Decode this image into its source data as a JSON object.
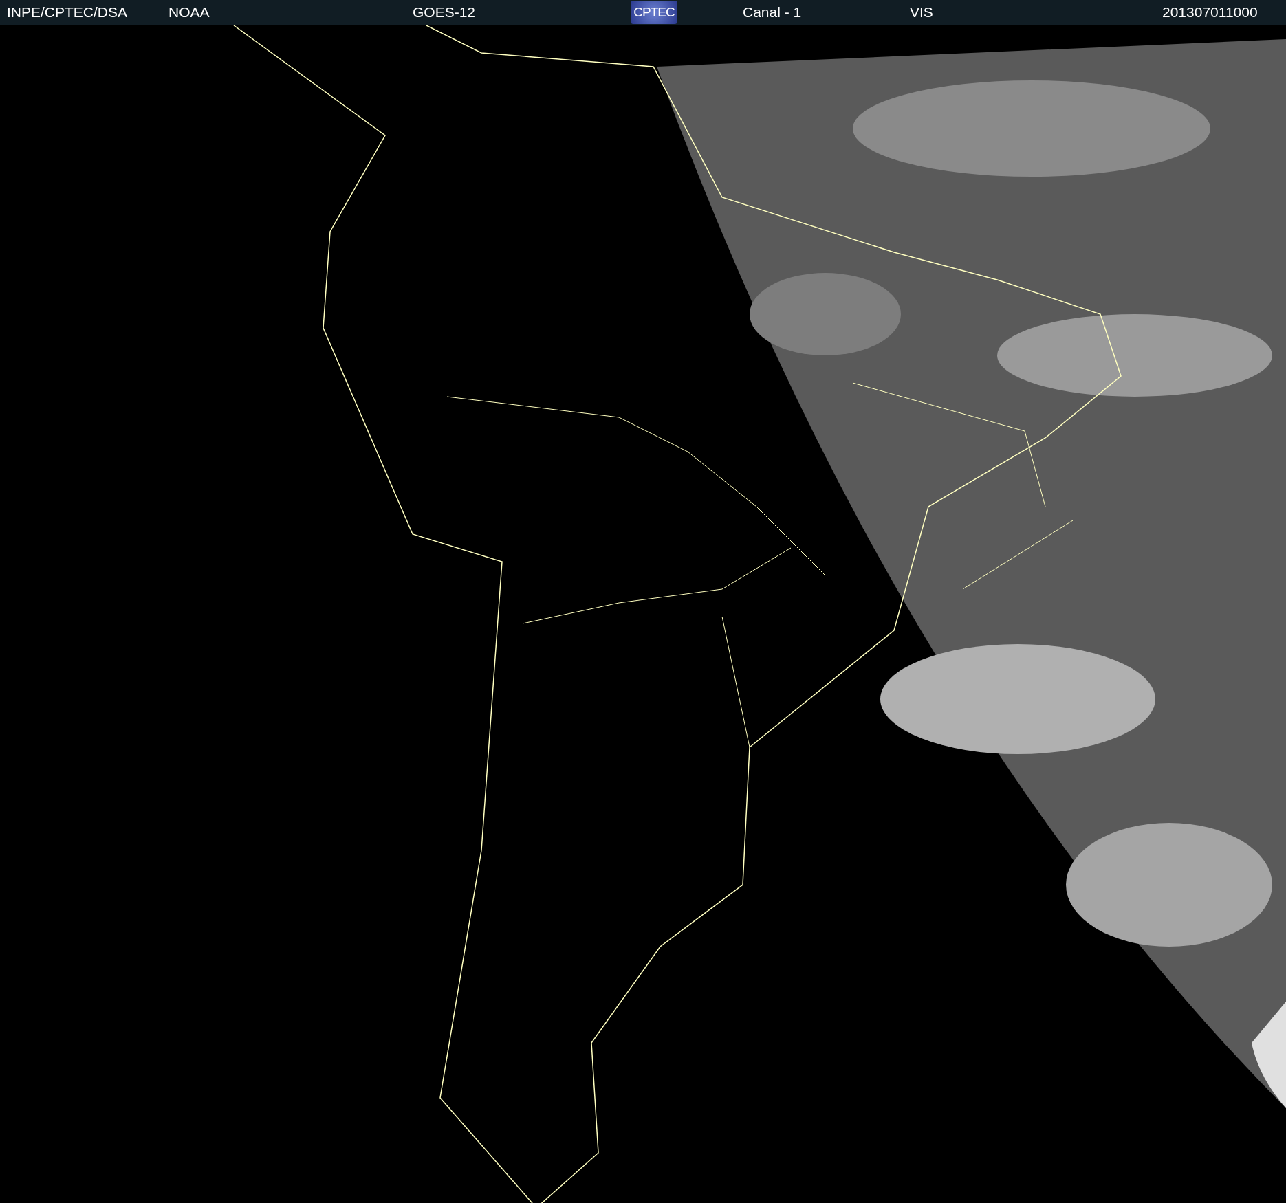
{
  "header": {
    "items": [
      {
        "kind": "text",
        "text": "INPE/CPTEC/DSA"
      },
      {
        "kind": "text",
        "text": "NOAA"
      },
      {
        "kind": "text",
        "text": "GOES-12"
      },
      {
        "kind": "logo",
        "text": "CPTEC"
      },
      {
        "kind": "text",
        "text": "Canal - 1"
      },
      {
        "kind": "text",
        "text": "VIS"
      },
      {
        "kind": "text",
        "text": "201307011000"
      }
    ]
  }
}
